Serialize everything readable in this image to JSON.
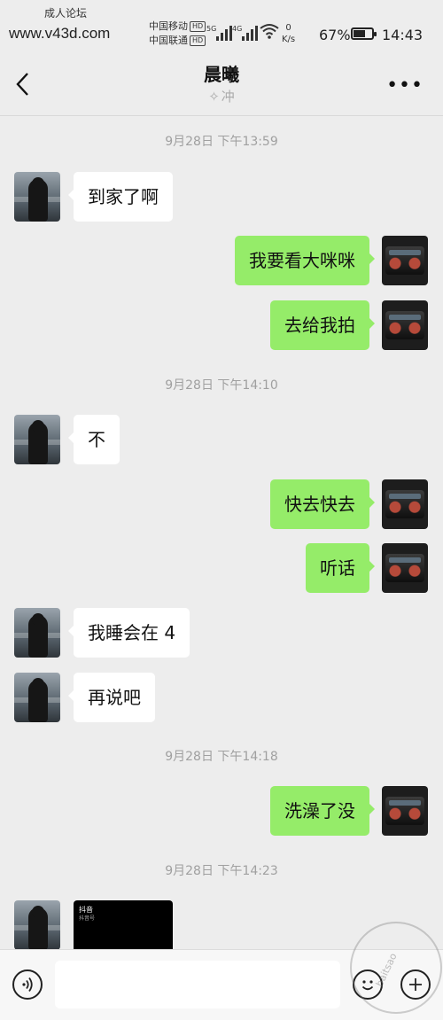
{
  "status_bar": {
    "watermark_top": "成人论坛",
    "watermark_url": "www.v43d.com",
    "carrier1": "中国移动",
    "carrier2": "中国联通",
    "hd_badge": "HD",
    "sig1": "5G",
    "sig2": "4G",
    "net_speed_value": "0",
    "net_speed_unit": "K/s",
    "battery_percent": "67%",
    "battery_level": 0.67,
    "time": "14:43"
  },
  "header": {
    "title": "晨曦",
    "subtitle_icon": "cheer-icon",
    "subtitle": "冲",
    "more_label": "•••"
  },
  "messages": [
    {
      "type": "timestamp",
      "text": "9月28日 下午13:59"
    },
    {
      "type": "text",
      "side": "left",
      "text": "到家了啊"
    },
    {
      "type": "text",
      "side": "right",
      "text": "我要看大咪咪"
    },
    {
      "type": "text",
      "side": "right",
      "text": "去给我拍"
    },
    {
      "type": "timestamp",
      "text": "9月28日 下午14:10"
    },
    {
      "type": "text",
      "side": "left",
      "text": "不"
    },
    {
      "type": "text",
      "side": "right",
      "text": "快去快去"
    },
    {
      "type": "text",
      "side": "right",
      "text": "听话"
    },
    {
      "type": "text",
      "side": "left",
      "text": "我睡会在 4"
    },
    {
      "type": "text",
      "side": "left",
      "text": "再说吧"
    },
    {
      "type": "timestamp",
      "text": "9月28日 下午14:18"
    },
    {
      "type": "text",
      "side": "right",
      "text": "洗澡了没"
    },
    {
      "type": "timestamp",
      "text": "9月28日 下午14:23"
    },
    {
      "type": "video",
      "side": "left",
      "logo": "抖音",
      "id_text": "抖音号"
    }
  ],
  "input_bar": {
    "placeholder": "",
    "voice_icon": "voice-icon",
    "emoji_icon": "emoji-icon",
    "plus_icon": "plus-icon"
  },
  "stamp": {
    "text": "baitsao"
  },
  "colors": {
    "background": "#ededed",
    "bubble_self": "#95ec69",
    "bubble_other": "#ffffff",
    "timestamp": "#a0a0a0"
  }
}
